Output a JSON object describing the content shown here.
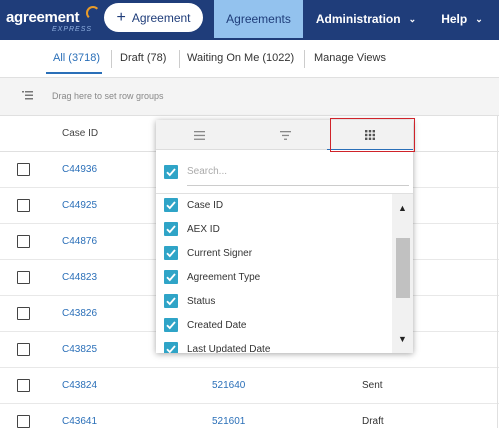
{
  "header": {
    "logo_main": "agreement",
    "logo_sub": "EXPRESS",
    "new_agreement_label": "Agreement",
    "nav": {
      "agreements": "Agreements",
      "administration": "Administration",
      "help": "Help"
    },
    "colors": {
      "navbar": "#1f3d7a",
      "active_tab": "#93c2ee",
      "link": "#2a6fb8",
      "checkbox": "#2fa4c7",
      "highlight_box": "#d0232a"
    }
  },
  "subtabs": {
    "all": "All (3718)",
    "draft": "Draft (78)",
    "waiting": "Waiting On Me (1022)",
    "manage": "Manage Views"
  },
  "groupbar": {
    "text": "Drag here to set row groups",
    "icon": "row-group-icon"
  },
  "grid": {
    "columns": {
      "case_id": "Case ID"
    },
    "rows": [
      {
        "case_id": "C44936",
        "aex_id": "",
        "status": ""
      },
      {
        "case_id": "C44925",
        "aex_id": "",
        "status": ""
      },
      {
        "case_id": "C44876",
        "aex_id": "",
        "status": ""
      },
      {
        "case_id": "C44823",
        "aex_id": "",
        "status": ""
      },
      {
        "case_id": "C43826",
        "aex_id": "",
        "status": ""
      },
      {
        "case_id": "C43825",
        "aex_id": "",
        "status": ""
      },
      {
        "case_id": "C43824",
        "aex_id": "521640",
        "status": "Sent"
      },
      {
        "case_id": "C43641",
        "aex_id": "521601",
        "status": "Draft"
      }
    ]
  },
  "column_menu": {
    "tabs": [
      "menu-icon",
      "filter-icon",
      "columns-icon"
    ],
    "active_tab": "columns-icon",
    "search_placeholder": "Search...",
    "search_value": "",
    "select_all_checked": true,
    "columns": [
      {
        "label": "Case ID",
        "checked": true
      },
      {
        "label": "AEX ID",
        "checked": true
      },
      {
        "label": "Current Signer",
        "checked": true
      },
      {
        "label": "Agreement Type",
        "checked": true
      },
      {
        "label": "Status",
        "checked": true
      },
      {
        "label": "Created Date",
        "checked": true
      },
      {
        "label": "Last Updated Date",
        "checked": true
      }
    ]
  }
}
